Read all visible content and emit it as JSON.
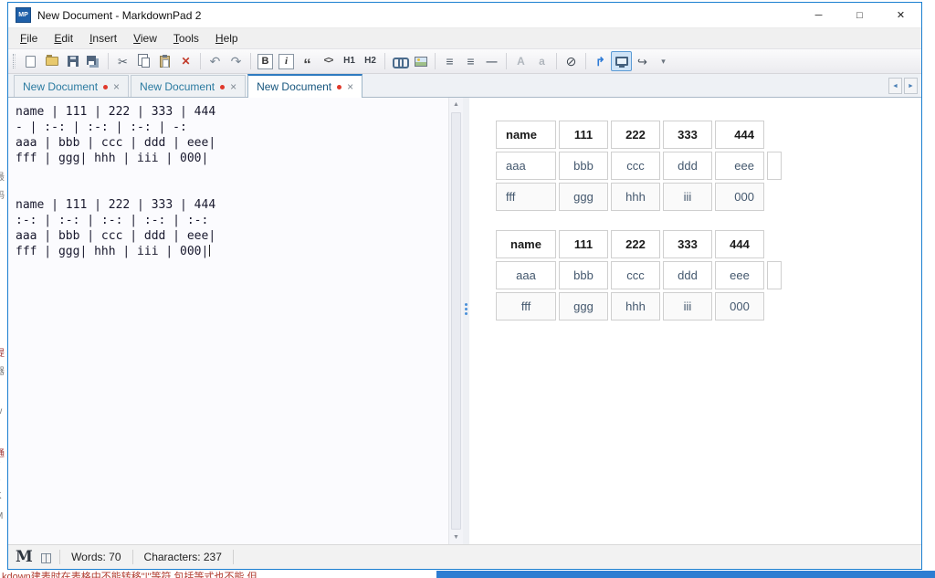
{
  "window": {
    "icon_label": "MP",
    "title": "New Document - MarkdownPad 2",
    "controls": {
      "minimize": "─",
      "maximize": "□",
      "close": "✕"
    }
  },
  "menu": [
    "File",
    "Edit",
    "Insert",
    "View",
    "Tools",
    "Help"
  ],
  "toolbar": {
    "items": [
      {
        "name": "new-document",
        "glyph": ""
      },
      {
        "name": "open-file",
        "glyph": ""
      },
      {
        "name": "save",
        "glyph": ""
      },
      {
        "name": "save-all",
        "glyph": ""
      },
      {
        "name": "cut",
        "glyph": "✂"
      },
      {
        "name": "copy",
        "glyph": ""
      },
      {
        "name": "paste",
        "glyph": ""
      },
      {
        "name": "delete",
        "glyph": "✕"
      },
      {
        "name": "undo",
        "glyph": "↶"
      },
      {
        "name": "redo",
        "glyph": "↷"
      },
      {
        "name": "bold",
        "glyph": "B"
      },
      {
        "name": "italic",
        "glyph": "i"
      },
      {
        "name": "blockquote",
        "glyph": "“"
      },
      {
        "name": "inline-code",
        "glyph": "<>"
      },
      {
        "name": "heading-1",
        "glyph": "H1"
      },
      {
        "name": "heading-2",
        "glyph": "H2"
      },
      {
        "name": "hyperlink",
        "glyph": ""
      },
      {
        "name": "image",
        "glyph": ""
      },
      {
        "name": "bullet-list",
        "glyph": "≡"
      },
      {
        "name": "numbered-list",
        "glyph": "≡"
      },
      {
        "name": "horizontal-rule",
        "glyph": "—"
      },
      {
        "name": "uppercase",
        "glyph": "A"
      },
      {
        "name": "lowercase",
        "glyph": "a"
      },
      {
        "name": "timestamp",
        "glyph": "⊘"
      },
      {
        "name": "scroll-sync",
        "glyph": "↱"
      },
      {
        "name": "live-preview",
        "glyph": ""
      },
      {
        "name": "export",
        "glyph": "↪"
      },
      {
        "name": "toolbar-overflow",
        "glyph": "▾"
      }
    ]
  },
  "tabs": {
    "items": [
      {
        "label": "New Document",
        "modified": true
      },
      {
        "label": "New Document",
        "modified": true
      },
      {
        "label": "New Document",
        "modified": true
      }
    ],
    "active_index": 2,
    "close_glyph": "×"
  },
  "tabnav": {
    "prev": "◄",
    "next": "►"
  },
  "scrollbar": {
    "up": "▲",
    "down": "▼"
  },
  "editor": {
    "lines": [
      "name | 111 | 222 | 333 | 444",
      "- | :-: | :-: | :-: | -:",
      "aaa | bbb | ccc | ddd | eee|",
      "fff | ggg| hhh | iii | 000|",
      "",
      "",
      "name | 111 | 222 | 333 | 444",
      ":-: | :-: | :-: | :-: | :-:",
      "aaa | bbb | ccc | ddd | eee|",
      "fff | ggg| hhh | iii | 000|"
    ]
  },
  "preview": {
    "tables": [
      {
        "header": [
          "name",
          "111",
          "222",
          "333",
          "444"
        ],
        "rows": [
          [
            "aaa",
            "bbb",
            "ccc",
            "ddd",
            "eee",
            ""
          ],
          [
            "fff",
            "ggg",
            "hhh",
            "iii",
            "000"
          ]
        ]
      },
      {
        "header": [
          "name",
          "111",
          "222",
          "333",
          "444"
        ],
        "rows": [
          [
            "aaa",
            "bbb",
            "ccc",
            "ddd",
            "eee",
            ""
          ],
          [
            "fff",
            "ggg",
            "hhh",
            "iii",
            "000"
          ]
        ]
      }
    ]
  },
  "statusbar": {
    "logo": "M",
    "book_icon": "◫",
    "words": "Words: 70",
    "characters": "Characters: 237"
  },
  "artifacts": {
    "bottom_text": "kdown建表时在表格中不能转移\"|\"等符,包括等式也不能,但",
    "left_glyphs": [
      "最",
      "码",
      "2",
      "1",
      "提",
      "器",
      "w",
      "d",
      "通",
      "7",
      "6",
      "K",
      "M"
    ]
  }
}
